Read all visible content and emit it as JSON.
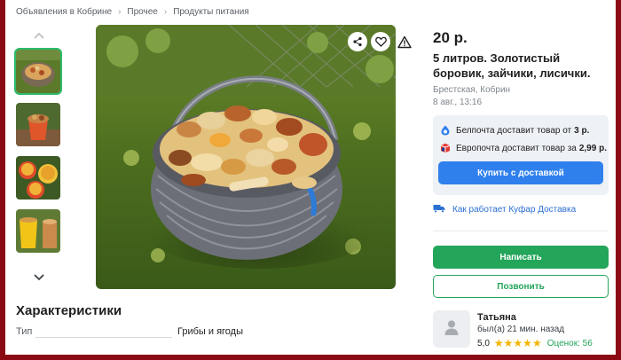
{
  "breadcrumbs": [
    "Объявления в Кобрине",
    "Прочее",
    "Продукты питания"
  ],
  "listing": {
    "price": "20 р.",
    "title": "5 литров. Золотистый боровик, зайчики, лисички.",
    "location": "Брестская, Кобрин",
    "date": "8 авг., 13:16"
  },
  "delivery": {
    "belpochta_text": "Белпочта доставит товар от",
    "belpochta_price": "3 р.",
    "europochta_text": "Европочта доставит товар за",
    "europochta_price": "2,99 р.",
    "buy_button": "Купить с доставкой",
    "how_link": "Как работает Куфар Доставка"
  },
  "actions": {
    "write": "Написать",
    "call": "Позвонить"
  },
  "seller": {
    "name": "Татьяна",
    "last_seen": "был(а) 21 мин. назад",
    "rating": "5,0",
    "stars": "★★★★★",
    "reviews": "Оценок: 56"
  },
  "characteristics": {
    "title": "Характеристики",
    "rows": [
      {
        "label": "Тип",
        "value": "Грибы и ягоды"
      }
    ]
  },
  "icons": {
    "thumb_up": "chevron-up-icon",
    "thumb_down": "chevron-down-icon",
    "share": "share-icon",
    "favorite": "heart-icon",
    "report": "warning-icon",
    "belpochta": "belpochta-logo-icon",
    "europochta": "europochta-logo-icon",
    "truck": "truck-icon",
    "avatar": "user-icon"
  },
  "colors": {
    "primary_blue": "#2f80ed",
    "primary_green": "#23a55a",
    "star": "#f4b400",
    "frame": "#8b0a14"
  }
}
